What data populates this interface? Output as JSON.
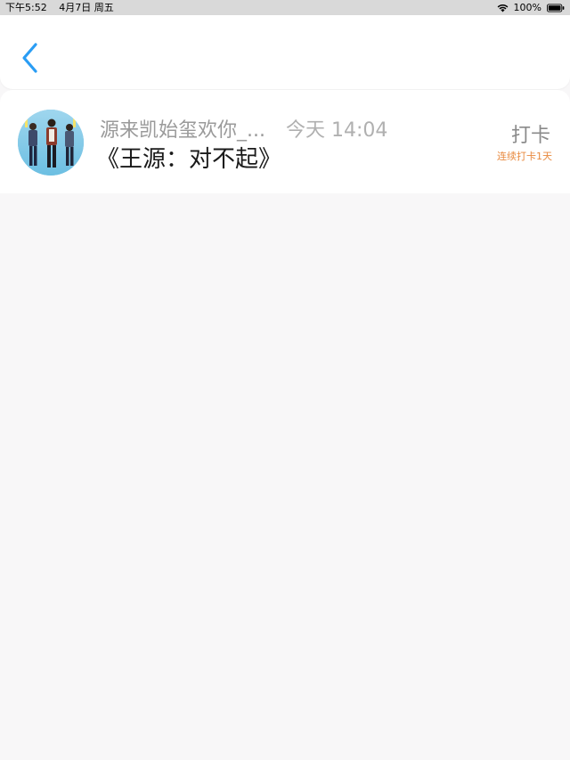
{
  "status_bar": {
    "time": "下午5:52",
    "date": "4月7日 周五",
    "battery": "100%"
  },
  "nav": {
    "back_icon": "chevron-left-icon",
    "accent_color": "#2a9df4"
  },
  "post": {
    "author": "源来凯始玺欢你_...",
    "time": "今天 14:04",
    "title": "《王源：对不起》",
    "checkin_label": "打卡",
    "streak_label": "连续打卡1天",
    "streak_color": "#e8893e"
  }
}
